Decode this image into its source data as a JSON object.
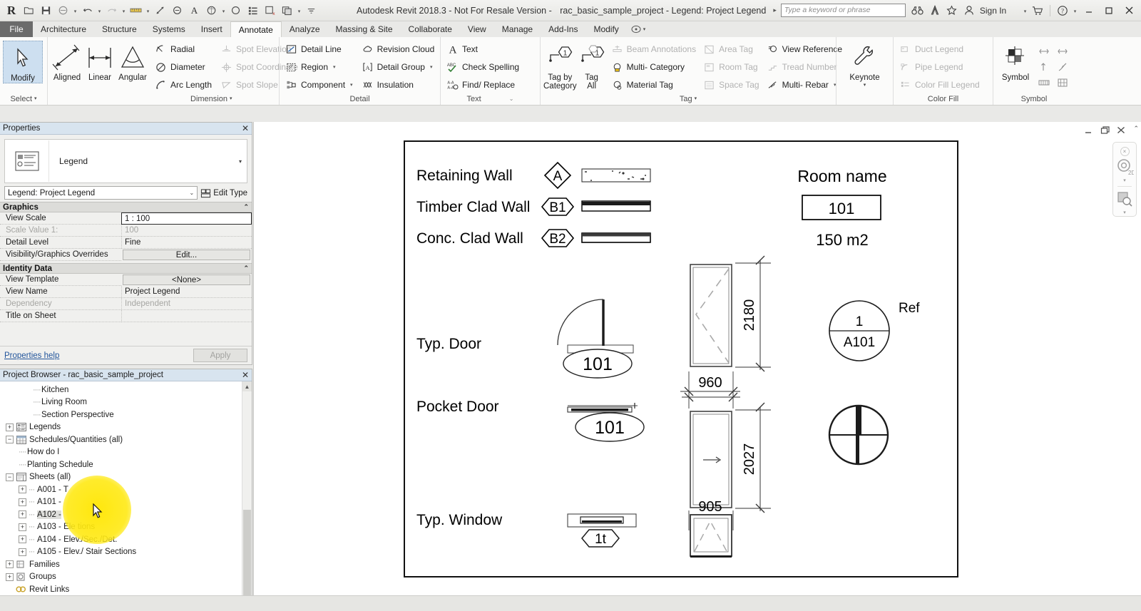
{
  "titlebar": {
    "app_title": "Autodesk Revit 2018.3 - Not For Resale Version -",
    "document_title": "rac_basic_sample_project - Legend: Project Legend",
    "search_placeholder": "Type a keyword or phrase",
    "sign_in": "Sign In",
    "quick_access": [
      "revit-logo",
      "open-icon",
      "save-icon",
      "save-as-icon",
      "undo-icon",
      "redo-icon",
      "measure-icon",
      "aligned-dimension-icon",
      "tag-icon",
      "text-icon",
      "default-3d-view-icon",
      "section-icon",
      "thin-lines-icon",
      "close-hidden-icon",
      "switch-window-icon",
      "customize-icon"
    ],
    "right_icons": [
      "binoculars-icon",
      "a360-icon",
      "favorites-star-icon",
      "account-icon"
    ],
    "window_buttons": [
      "minimize",
      "maximize",
      "close"
    ]
  },
  "ribbon": {
    "tabs": [
      "File",
      "Architecture",
      "Structure",
      "Systems",
      "Insert",
      "Annotate",
      "Analyze",
      "Massing & Site",
      "Collaborate",
      "View",
      "Manage",
      "Add-Ins",
      "Modify"
    ],
    "active_tab": "Annotate",
    "panels": [
      {
        "title": "Select",
        "title_caret": true,
        "big_buttons": [
          {
            "label": "Modify",
            "icon": "arrow-cursor-icon",
            "selected": true
          }
        ]
      },
      {
        "title": "Dimension",
        "title_caret": true,
        "big_buttons": [
          {
            "label": "Aligned",
            "icon": "aligned-dimension-icon",
            "selected": false
          },
          {
            "label": "Linear",
            "icon": "linear-dimension-icon",
            "selected": false
          },
          {
            "label": "Angular",
            "icon": "angular-dimension-icon",
            "selected": false
          }
        ],
        "columns": [
          [
            {
              "label": "Radial",
              "icon": "radial-dimension-icon",
              "disabled": false
            },
            {
              "label": "Diameter",
              "icon": "diameter-dimension-icon",
              "disabled": false
            },
            {
              "label": "Arc Length",
              "icon": "arc-length-icon",
              "disabled": false
            }
          ],
          [
            {
              "label": "Spot Elevation",
              "icon": "spot-elevation-icon",
              "disabled": true
            },
            {
              "label": "Spot Coordinate",
              "icon": "spot-coordinate-icon",
              "disabled": true
            },
            {
              "label": "Spot Slope",
              "icon": "spot-slope-icon",
              "disabled": true
            }
          ]
        ]
      },
      {
        "title": "Detail",
        "title_caret": false,
        "columns": [
          [
            {
              "label": "Detail Line",
              "icon": "detail-line-icon",
              "disabled": false
            },
            {
              "label": "Region",
              "icon": "region-icon",
              "disabled": false,
              "caret": true
            },
            {
              "label": "Component",
              "icon": "component-icon",
              "disabled": false,
              "caret": true
            }
          ],
          [
            {
              "label": "Revision Cloud",
              "icon": "revision-cloud-icon",
              "disabled": false
            },
            {
              "label": "Detail Group",
              "icon": "detail-group-icon",
              "disabled": false,
              "caret": true
            },
            {
              "label": "Insulation",
              "icon": "insulation-icon",
              "disabled": false
            }
          ]
        ]
      },
      {
        "title": "Text",
        "title_caret": false,
        "columns": [
          [
            {
              "label": "Text",
              "icon": "text-icon",
              "disabled": false
            },
            {
              "label": "Check Spelling",
              "icon": "check-spelling-icon",
              "disabled": false
            },
            {
              "label": "Find/ Replace",
              "icon": "find-replace-icon",
              "disabled": false
            }
          ]
        ]
      },
      {
        "title": "Tag",
        "title_caret": true,
        "big_buttons": [
          {
            "label": "Tag by\nCategory",
            "icon": "tag-by-category-icon",
            "selected": false
          },
          {
            "label": "Tag\nAll",
            "icon": "tag-all-icon",
            "selected": false
          }
        ],
        "columns": [
          [
            {
              "label": "Beam Annotations",
              "icon": "beam-annotations-icon",
              "disabled": true
            },
            {
              "label": "Multi- Category",
              "icon": "multi-category-tag-icon",
              "disabled": false
            },
            {
              "label": "Material Tag",
              "icon": "material-tag-icon",
              "disabled": false
            }
          ],
          [
            {
              "label": "Area Tag",
              "icon": "area-tag-icon",
              "disabled": true
            },
            {
              "label": "Room Tag",
              "icon": "room-tag-icon",
              "disabled": true
            },
            {
              "label": "Space Tag",
              "icon": "space-tag-icon",
              "disabled": true
            }
          ],
          [
            {
              "label": "View Reference",
              "icon": "view-reference-icon",
              "disabled": false
            },
            {
              "label": "Tread Number",
              "icon": "tread-number-icon",
              "disabled": true
            },
            {
              "label": "Multi- Rebar",
              "icon": "multi-rebar-icon",
              "disabled": false,
              "caret": true
            }
          ]
        ]
      },
      {
        "title": "",
        "title_caret": false,
        "big_buttons": [
          {
            "label": "Keynote",
            "icon": "keynote-wrench-icon",
            "selected": false,
            "caret": true
          }
        ]
      },
      {
        "title": "Color Fill",
        "title_caret": false,
        "columns": [
          [
            {
              "label": "Duct Legend",
              "icon": "duct-legend-icon",
              "disabled": true
            },
            {
              "label": "Pipe Legend",
              "icon": "pipe-legend-icon",
              "disabled": true
            },
            {
              "label": "Color Fill Legend",
              "icon": "color-fill-legend-icon",
              "disabled": true
            }
          ]
        ]
      },
      {
        "title": "Symbol",
        "title_caret": false,
        "big_buttons": [
          {
            "label": "Symbol",
            "icon": "symbol-icon",
            "selected": false
          }
        ],
        "tiny_icons": [
          "span-direction-icon",
          "beam-system-icon",
          "stair-path-icon",
          "area-reinforcement-icon",
          "path-reinforcement-icon",
          "fabric-sheet-icon"
        ]
      }
    ]
  },
  "properties": {
    "panel_title": "Properties",
    "type_name": "Legend",
    "instance_selector": "Legend: Project Legend",
    "edit_type_label": "Edit Type",
    "groups": [
      {
        "name": "Graphics",
        "rows": [
          {
            "key": "View Scale",
            "value": "1 : 100",
            "disabled": false,
            "style": "boxed"
          },
          {
            "key": "Scale Value    1:",
            "value": "100",
            "disabled": true,
            "style": "plain"
          },
          {
            "key": "Detail Level",
            "value": "Fine",
            "disabled": false,
            "style": "plain"
          },
          {
            "key": "Visibility/Graphics Overrides",
            "value": "Edit...",
            "disabled": false,
            "style": "button"
          }
        ]
      },
      {
        "name": "Identity Data",
        "rows": [
          {
            "key": "View Template",
            "value": "<None>",
            "disabled": false,
            "style": "button"
          },
          {
            "key": "View Name",
            "value": "Project Legend",
            "disabled": false,
            "style": "plain"
          },
          {
            "key": "Dependency",
            "value": "Independent",
            "disabled": true,
            "style": "plain"
          },
          {
            "key": "Title on Sheet",
            "value": "",
            "disabled": false,
            "style": "plain"
          }
        ]
      }
    ],
    "help_link": "Properties help",
    "apply_label": "Apply"
  },
  "browser": {
    "panel_title": "Project Browser - rac_basic_sample_project",
    "nodes": [
      {
        "label": "Kitchen",
        "depth": 3,
        "expander": "none",
        "icon": "none",
        "selected": false
      },
      {
        "label": "Living Room",
        "depth": 3,
        "expander": "none",
        "icon": "none",
        "selected": false
      },
      {
        "label": "Section Perspective",
        "depth": 3,
        "expander": "none",
        "icon": "none",
        "selected": false
      },
      {
        "label": "Legends",
        "depth": 1,
        "expander": "plus",
        "icon": "legend-icon",
        "selected": false
      },
      {
        "label": "Schedules/Quantities (all)",
        "depth": 1,
        "expander": "minus",
        "icon": "schedule-icon",
        "selected": false
      },
      {
        "label": "How do I",
        "depth": 2,
        "expander": "none",
        "icon": "none",
        "selected": false
      },
      {
        "label": "Planting Schedule",
        "depth": 2,
        "expander": "none",
        "icon": "none",
        "selected": false
      },
      {
        "label": "Sheets (all)",
        "depth": 1,
        "expander": "minus",
        "icon": "sheet-icon",
        "selected": false
      },
      {
        "label": "A001 - T",
        "depth": 2,
        "expander": "plus",
        "icon": "none",
        "selected": false
      },
      {
        "label": "A101 -",
        "depth": 2,
        "expander": "plus",
        "icon": "none",
        "selected": false
      },
      {
        "label": "A102 -",
        "depth": 2,
        "expander": "plus",
        "icon": "none",
        "selected": true
      },
      {
        "label": "A103 - Ele                 tions",
        "depth": 2,
        "expander": "plus",
        "icon": "none",
        "selected": false
      },
      {
        "label": "A104 - Elev./Sec./Det.",
        "depth": 2,
        "expander": "plus",
        "icon": "none",
        "selected": false
      },
      {
        "label": "A105 - Elev./ Stair Sections",
        "depth": 2,
        "expander": "plus",
        "icon": "none",
        "selected": false
      },
      {
        "label": "Families",
        "depth": 1,
        "expander": "plus",
        "icon": "families-icon",
        "selected": false
      },
      {
        "label": "Groups",
        "depth": 1,
        "expander": "plus",
        "icon": "groups-icon",
        "selected": false
      },
      {
        "label": "Revit Links",
        "depth": 1,
        "expander": "none",
        "icon": "revit-links-icon",
        "selected": false
      }
    ]
  },
  "legend_sheet": {
    "wall_rows": [
      {
        "label": "Retaining Wall",
        "tag": "A",
        "tag_shape": "diamond",
        "swatch": "hatched-thin"
      },
      {
        "label": "Timber Clad Wall",
        "tag": "B1",
        "tag_shape": "diamond-wide",
        "swatch": "solid-thick"
      },
      {
        "label": "Conc. Clad Wall",
        "tag": "B2",
        "tag_shape": "diamond-wide",
        "swatch": "dotted-top"
      }
    ],
    "door_rows": [
      {
        "label": "Typ. Door",
        "tag": "101",
        "elevation_height": "2180",
        "elevation_width": "960"
      },
      {
        "label": "Pocket Door",
        "tag": "101",
        "elevation_height": "2027",
        "elevation_width": "905"
      },
      {
        "label": "Typ. Window",
        "tag": "1t",
        "elevation_width": "905"
      }
    ],
    "room_block": {
      "title": "Room name",
      "number": "101",
      "area": "150 m2"
    },
    "section_marker": {
      "detail": "1",
      "sheet": "A101",
      "label": "Ref"
    }
  },
  "canvas": {
    "view_controls": [
      "minimize-view-icon",
      "restore-view-icon",
      "close-view-icon"
    ],
    "nav_tools": [
      "steering-wheel-2d-icon",
      "zoom-region-icon"
    ]
  }
}
